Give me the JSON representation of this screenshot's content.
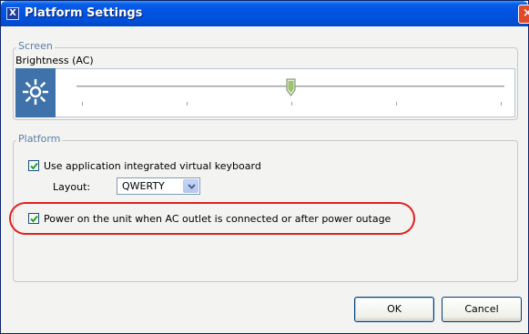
{
  "window": {
    "title": "Platform Settings",
    "app_icon_glyph": "X",
    "close_glyph": "×"
  },
  "screen": {
    "legend": "Screen",
    "brightness_label": "Brightness (AC)",
    "brightness_level": 0.5,
    "icon": "sun-icon"
  },
  "platform": {
    "legend": "Platform",
    "virtual_keyboard": {
      "label": "Use application integrated virtual keyboard",
      "checked": true
    },
    "layout": {
      "label": "Layout:",
      "value": "QWERTY"
    },
    "power_on": {
      "label": "Power on the unit when AC outlet is connected or after power outage",
      "checked": true
    }
  },
  "buttons": {
    "ok": "OK",
    "cancel": "Cancel"
  },
  "colors": {
    "titlebar": "#0054e3",
    "legend_text": "#5a7fa8",
    "sun_box": "#3f72aa",
    "highlight": "#e02020"
  }
}
